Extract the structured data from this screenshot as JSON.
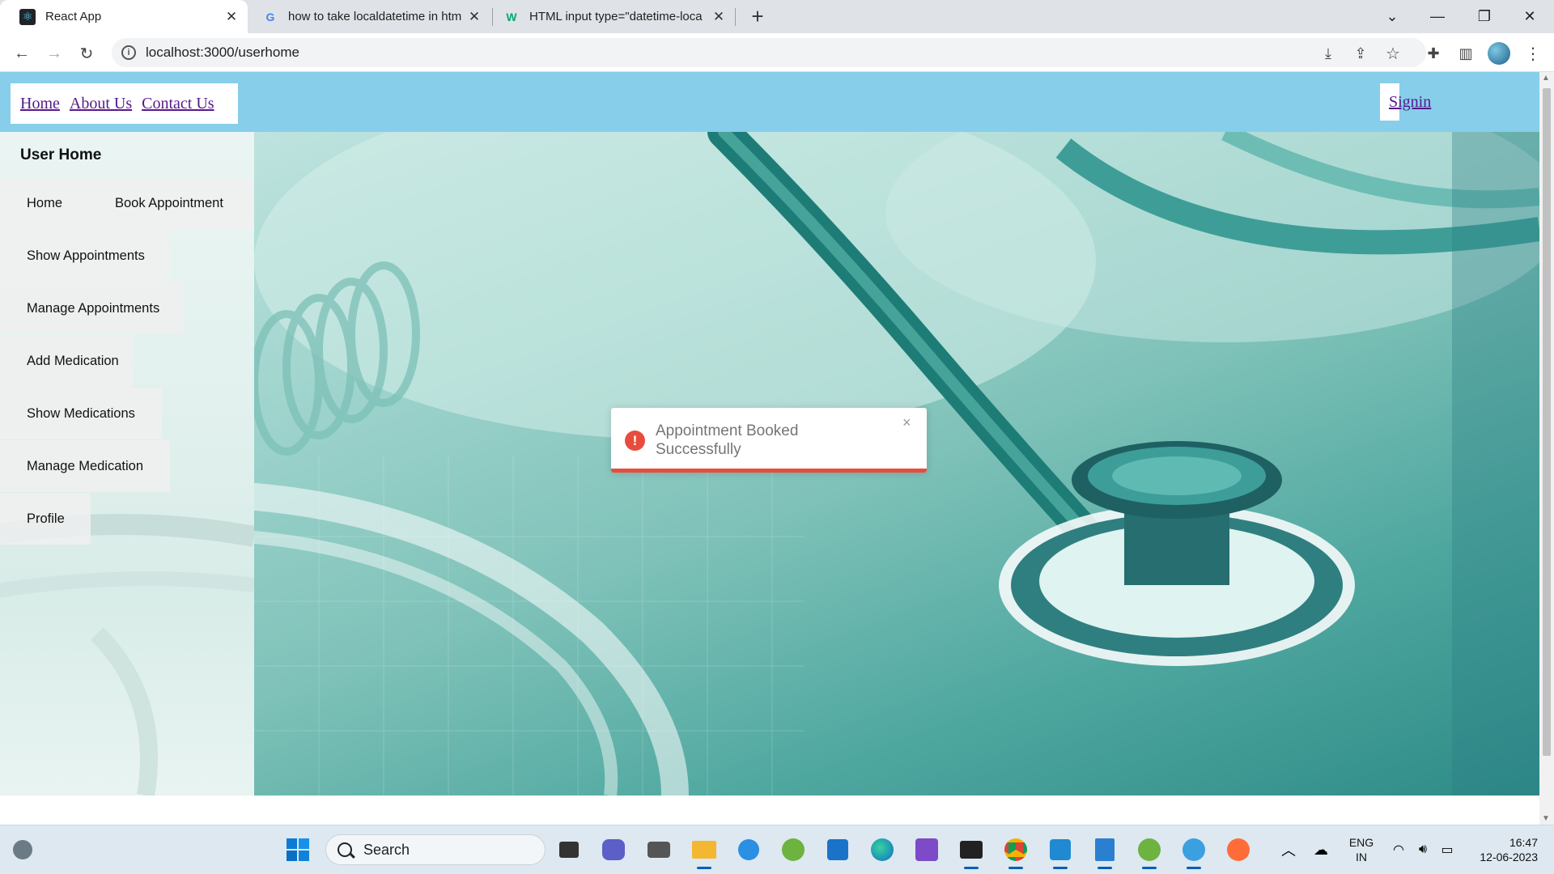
{
  "browser": {
    "tabs": [
      {
        "title": "React App",
        "active": true,
        "favicon": "react-icon"
      },
      {
        "title": "how to take localdatetime in htm",
        "active": false,
        "favicon": "google-icon"
      },
      {
        "title": "HTML input type=\"datetime-loca",
        "active": false,
        "favicon": "w3schools-icon"
      }
    ],
    "url": "localhost:3000/userhome"
  },
  "topnav": {
    "links": [
      "Home",
      "About Us",
      "Contact Us"
    ],
    "signin": "Signin"
  },
  "sidebar": {
    "title": "User Home",
    "items": [
      "Home",
      "Book Appointment",
      "Show Appointments",
      "Manage Appointments",
      "Add Medication",
      "Show Medications",
      "Manage Medication",
      "Profile"
    ]
  },
  "toast": {
    "message": "Appointment Booked Successfully",
    "close": "×",
    "type": "error",
    "accent": "#e74c3c",
    "progress": 1.0
  },
  "taskbar": {
    "search_placeholder": "Search",
    "language": "ENG",
    "region": "IN",
    "time": "16:47",
    "date": "12-06-2023"
  },
  "colors": {
    "nav_bg": "#87ceeb",
    "link": "#551a8b"
  }
}
